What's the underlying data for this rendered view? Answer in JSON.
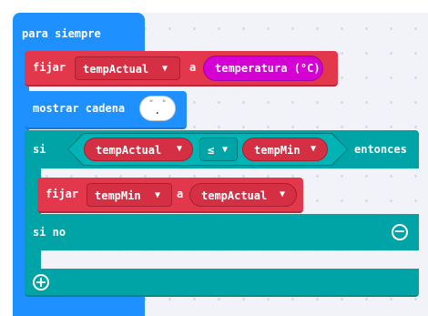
{
  "forever": {
    "label": "para siempre"
  },
  "set_temp": {
    "label": "fijar",
    "variable": "tempActual",
    "connector": "a",
    "value": "temperatura (°C)"
  },
  "show_string": {
    "label": "mostrar cadena",
    "value": "\" \"  \".\""
  },
  "if_else": {
    "if_label": "si",
    "then_label": "entonces",
    "else_label": "si no",
    "condition": {
      "left": "tempActual",
      "operator": "≤",
      "right": "tempMin"
    },
    "remove_icon": "⊖",
    "add_icon": "⊕"
  },
  "set_min": {
    "label": "fijar",
    "variable": "tempMin",
    "connector": "a",
    "value": "tempActual"
  },
  "icons": {
    "dropdown": "▼"
  },
  "colors": {
    "loops": "#1e90ff",
    "variables": "#e3384c",
    "logic": "#00a4a6",
    "input": "#d400d4",
    "workspace": "#f1f3f8"
  }
}
